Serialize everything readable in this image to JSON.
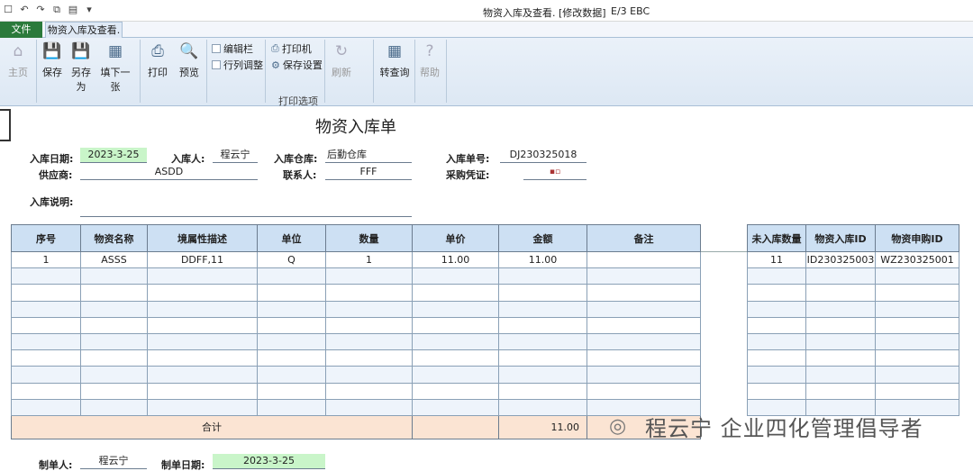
{
  "window": {
    "title": "物资入库及查看. [修改数据]",
    "title_right": "E/3 EBC"
  },
  "tabs": {
    "file": "文件",
    "active": "物资入库及查看."
  },
  "ribbon": {
    "home": "主页",
    "save": "保存",
    "save_as": "另存为",
    "fill_next": "填下一张",
    "print": "打印",
    "preview": "预览",
    "edit_bar": "编辑栏",
    "row_col_adjust": "行列调整",
    "printer": "打印机",
    "save_settings": "保存设置",
    "print_options": "打印选项",
    "refresh": "刷新",
    "to_query": "转查询",
    "help": "帮助"
  },
  "form": {
    "title": "物资入库单",
    "date_label": "入库日期:",
    "date_value": "2023-3-25",
    "person_label": "入库人:",
    "person_value": "程云宁",
    "warehouse_label": "入库仓库:",
    "warehouse_value": "后勤仓库",
    "number_label": "入库单号:",
    "number_value": "DJ230325018",
    "supplier_label": "供应商:",
    "supplier_value": "ASDD",
    "contact_label": "联系人:",
    "contact_value": "FFF",
    "voucher_label": "采购凭证:",
    "note_label": "入库说明:",
    "note_value": ""
  },
  "main_table": {
    "headers": [
      "序号",
      "物资名称",
      "境属性描述",
      "单位",
      "数量",
      "单价",
      "金额",
      "备注"
    ],
    "rows": [
      [
        "1",
        "ASSS",
        "DDFF,11",
        "Q",
        "1",
        "11.00",
        "11.00",
        ""
      ]
    ],
    "total_label": "合计",
    "total_amount": "11.00"
  },
  "side_table": {
    "headers": [
      "未入库数量",
      "物资入库ID",
      "物资申购ID"
    ],
    "rows": [
      [
        "11",
        "ID230325003",
        "WZ230325001"
      ]
    ]
  },
  "footer": {
    "maker_label": "制单人:",
    "maker_value": "程云宁",
    "make_date_label": "制单日期:",
    "make_date_value": "2023-3-25"
  },
  "watermark": {
    "text": "程云宁 企业四化管理倡导者"
  },
  "colors": {
    "green_field": "#c9f5c9",
    "header_blue": "#cde0f3",
    "total_row": "#fbe4d3",
    "file_tab": "#2b7a3b"
  }
}
